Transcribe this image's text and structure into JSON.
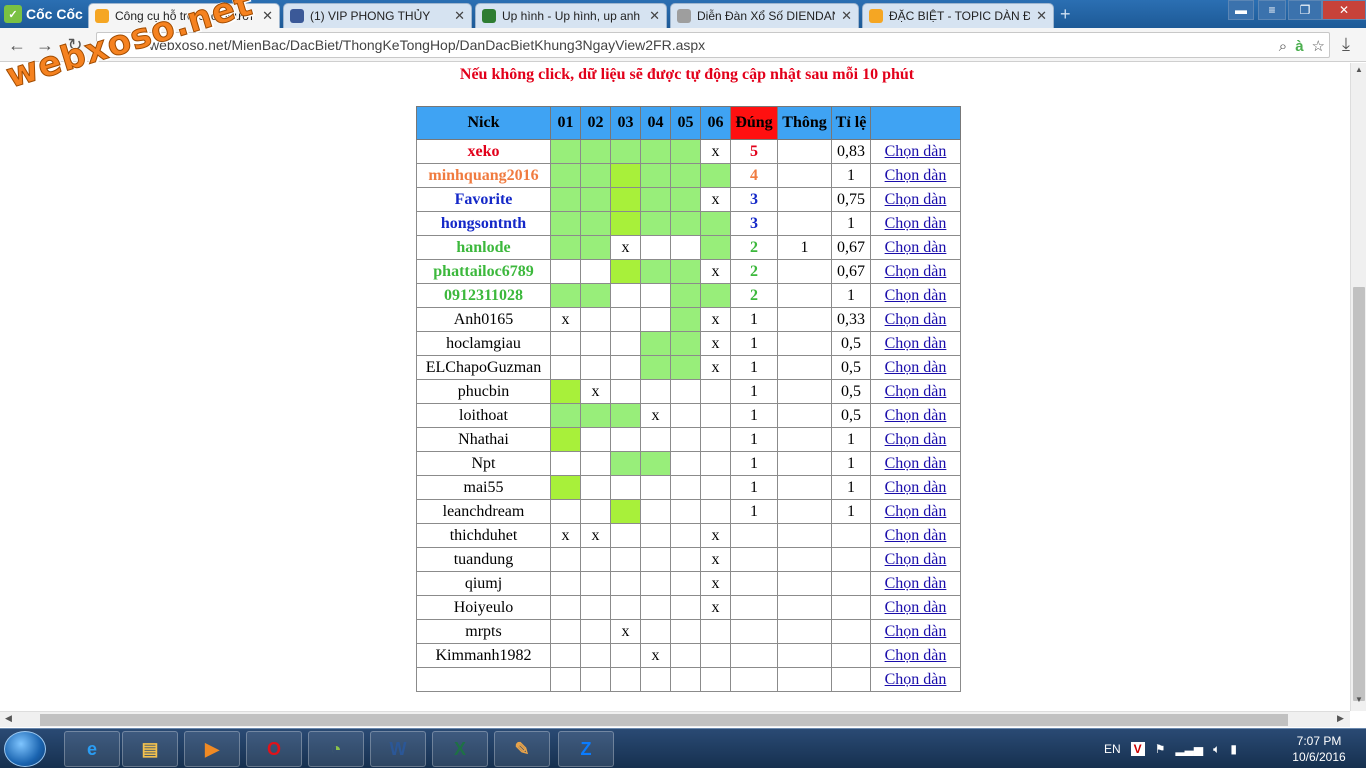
{
  "browser": {
    "brand": "Cốc Cốc",
    "tabs": [
      {
        "title": "Công cụ hỗ trợ cho người",
        "favicon": "xs-icon",
        "color": "#f5a623"
      },
      {
        "title": "(1) VIP PHONG THỦY",
        "favicon": "facebook-icon",
        "color": "#3b5998"
      },
      {
        "title": "Up hình - Up hình, up anh",
        "favicon": "image-icon",
        "color": "#2e7d32"
      },
      {
        "title": "Diễn Đàn Xổ Số DIENDAN",
        "favicon": "page-icon",
        "color": "#9e9e9e"
      },
      {
        "title": "ĐẶC BIỆT - TOPIC DÀN ĐẶ",
        "favicon": "xs-icon",
        "color": "#f5a623"
      }
    ],
    "url": "webxoso.net/MienBac/DacBiet/ThongKeTongHop/DanDacBietKhung3NgayView2FR.aspx",
    "watermark": "webxoso.net"
  },
  "page": {
    "notice": "Nếu không click, dữ liệu sẽ được tự động cập nhật sau mỗi 10 phút",
    "headers": [
      "Nick",
      "01",
      "02",
      "03",
      "04",
      "05",
      "06",
      "Đúng",
      "Thông",
      "Tỉ lệ",
      ""
    ],
    "rows": [
      {
        "nick": "xeko",
        "cells": [
          "g",
          "g",
          "g",
          "g",
          "g",
          "x"
        ],
        "dung": "5",
        "thong": "",
        "tile": "0,83",
        "link": "Chọn dàn",
        "color": "#e2001a"
      },
      {
        "nick": "minhquang2016",
        "cells": [
          "g",
          "g",
          "y",
          "g",
          "g",
          "g"
        ],
        "dung": "4",
        "thong": "",
        "tile": "1",
        "link": "Chọn dàn",
        "color": "#f07b3f"
      },
      {
        "nick": "Favorite",
        "cells": [
          "g",
          "g",
          "y",
          "g",
          "g",
          "x"
        ],
        "dung": "3",
        "thong": "",
        "tile": "0,75",
        "link": "Chọn dàn",
        "color": "#1428c8"
      },
      {
        "nick": "hongsontnth",
        "cells": [
          "g",
          "g",
          "y",
          "g",
          "g",
          "g"
        ],
        "dung": "3",
        "thong": "",
        "tile": "1",
        "link": "Chọn dàn",
        "color": "#1428c8"
      },
      {
        "nick": "hanlode",
        "cells": [
          "g",
          "g",
          "x",
          "",
          "",
          "g"
        ],
        "dung": "2",
        "thong": "1",
        "tile": "0,67",
        "link": "Chọn dàn",
        "color": "#3cb83c"
      },
      {
        "nick": "phattailoc6789",
        "cells": [
          "",
          "",
          "y",
          "g",
          "g",
          "x"
        ],
        "dung": "2",
        "thong": "",
        "tile": "0,67",
        "link": "Chọn dàn",
        "color": "#3cb83c"
      },
      {
        "nick": "0912311028",
        "cells": [
          "g",
          "g",
          "",
          "",
          "g",
          "g"
        ],
        "dung": "2",
        "thong": "",
        "tile": "1",
        "link": "Chọn dàn",
        "color": "#3cb83c"
      },
      {
        "nick": "Anh0165",
        "cells": [
          "x",
          "",
          "",
          "",
          "g",
          "x"
        ],
        "dung": "1",
        "thong": "",
        "tile": "0,33",
        "link": "Chọn dàn",
        "color": "#000000"
      },
      {
        "nick": "hoclamgiau",
        "cells": [
          "",
          "",
          "",
          "g",
          "g",
          "x"
        ],
        "dung": "1",
        "thong": "",
        "tile": "0,5",
        "link": "Chọn dàn",
        "color": "#000000"
      },
      {
        "nick": "ELChapoGuzman",
        "cells": [
          "",
          "",
          "",
          "g",
          "g",
          "x"
        ],
        "dung": "1",
        "thong": "",
        "tile": "0,5",
        "link": "Chọn dàn",
        "color": "#000000"
      },
      {
        "nick": "phucbin",
        "cells": [
          "y",
          "x",
          "",
          "",
          "",
          ""
        ],
        "dung": "1",
        "thong": "",
        "tile": "0,5",
        "link": "Chọn dàn",
        "color": "#000000"
      },
      {
        "nick": "loithoat",
        "cells": [
          "g",
          "g",
          "g",
          "x",
          "",
          ""
        ],
        "dung": "1",
        "thong": "",
        "tile": "0,5",
        "link": "Chọn dàn",
        "color": "#000000"
      },
      {
        "nick": "Nhathai",
        "cells": [
          "y",
          "",
          "",
          "",
          "",
          ""
        ],
        "dung": "1",
        "thong": "",
        "tile": "1",
        "link": "Chọn dàn",
        "color": "#000000"
      },
      {
        "nick": "Npt",
        "cells": [
          "",
          "",
          "g",
          "g",
          "",
          ""
        ],
        "dung": "1",
        "thong": "",
        "tile": "1",
        "link": "Chọn dàn",
        "color": "#000000"
      },
      {
        "nick": "mai55",
        "cells": [
          "y",
          "",
          "",
          "",
          "",
          ""
        ],
        "dung": "1",
        "thong": "",
        "tile": "1",
        "link": "Chọn dàn",
        "color": "#000000"
      },
      {
        "nick": "leanchdream",
        "cells": [
          "",
          "",
          "y",
          "",
          "",
          ""
        ],
        "dung": "1",
        "thong": "",
        "tile": "1",
        "link": "Chọn dàn",
        "color": "#000000"
      },
      {
        "nick": "thichduhet",
        "cells": [
          "x",
          "x",
          "",
          "",
          "",
          "x"
        ],
        "dung": "",
        "thong": "",
        "tile": "",
        "link": "Chọn dàn",
        "color": "#000000"
      },
      {
        "nick": "tuandung",
        "cells": [
          "",
          "",
          "",
          "",
          "",
          "x"
        ],
        "dung": "",
        "thong": "",
        "tile": "",
        "link": "Chọn dàn",
        "color": "#000000"
      },
      {
        "nick": "qiumj",
        "cells": [
          "",
          "",
          "",
          "",
          "",
          "x"
        ],
        "dung": "",
        "thong": "",
        "tile": "",
        "link": "Chọn dàn",
        "color": "#000000"
      },
      {
        "nick": "Hoiyeulo",
        "cells": [
          "",
          "",
          "",
          "",
          "",
          "x"
        ],
        "dung": "",
        "thong": "",
        "tile": "",
        "link": "Chọn dàn",
        "color": "#000000"
      },
      {
        "nick": "mrpts",
        "cells": [
          "",
          "",
          "x",
          "",
          "",
          ""
        ],
        "dung": "",
        "thong": "",
        "tile": "",
        "link": "Chọn dàn",
        "color": "#000000"
      },
      {
        "nick": "Kimmanh1982",
        "cells": [
          "",
          "",
          "",
          "x",
          "",
          ""
        ],
        "dung": "",
        "thong": "",
        "tile": "",
        "link": "Chọn dàn",
        "color": "#000000"
      },
      {
        "nick": "",
        "cells": [
          "",
          "",
          "",
          "",
          "",
          ""
        ],
        "dung": "",
        "thong": "",
        "tile": "",
        "link": "Chọn dàn",
        "color": "#000000"
      }
    ]
  },
  "taskbar": {
    "language": "EN",
    "time": "7:07 PM",
    "date": "10/6/2016",
    "apps": [
      {
        "name": "ie-icon",
        "glyph": "e",
        "color": "#2a9df4"
      },
      {
        "name": "explorer-icon",
        "glyph": "▤",
        "color": "#f2c14e"
      },
      {
        "name": "media-player-icon",
        "glyph": "▶",
        "color": "#f08a24"
      },
      {
        "name": "opera-icon",
        "glyph": "O",
        "color": "#e0121a"
      },
      {
        "name": "coccoc-icon",
        "glyph": "◔",
        "color": "#8bc34a"
      },
      {
        "name": "word-icon",
        "glyph": "W",
        "color": "#2b5797"
      },
      {
        "name": "excel-icon",
        "glyph": "X",
        "color": "#1e7145"
      },
      {
        "name": "paint-icon",
        "glyph": "✎",
        "color": "#e8a34a"
      },
      {
        "name": "zalo-icon",
        "glyph": "Z",
        "color": "#0a7cff"
      }
    ]
  }
}
